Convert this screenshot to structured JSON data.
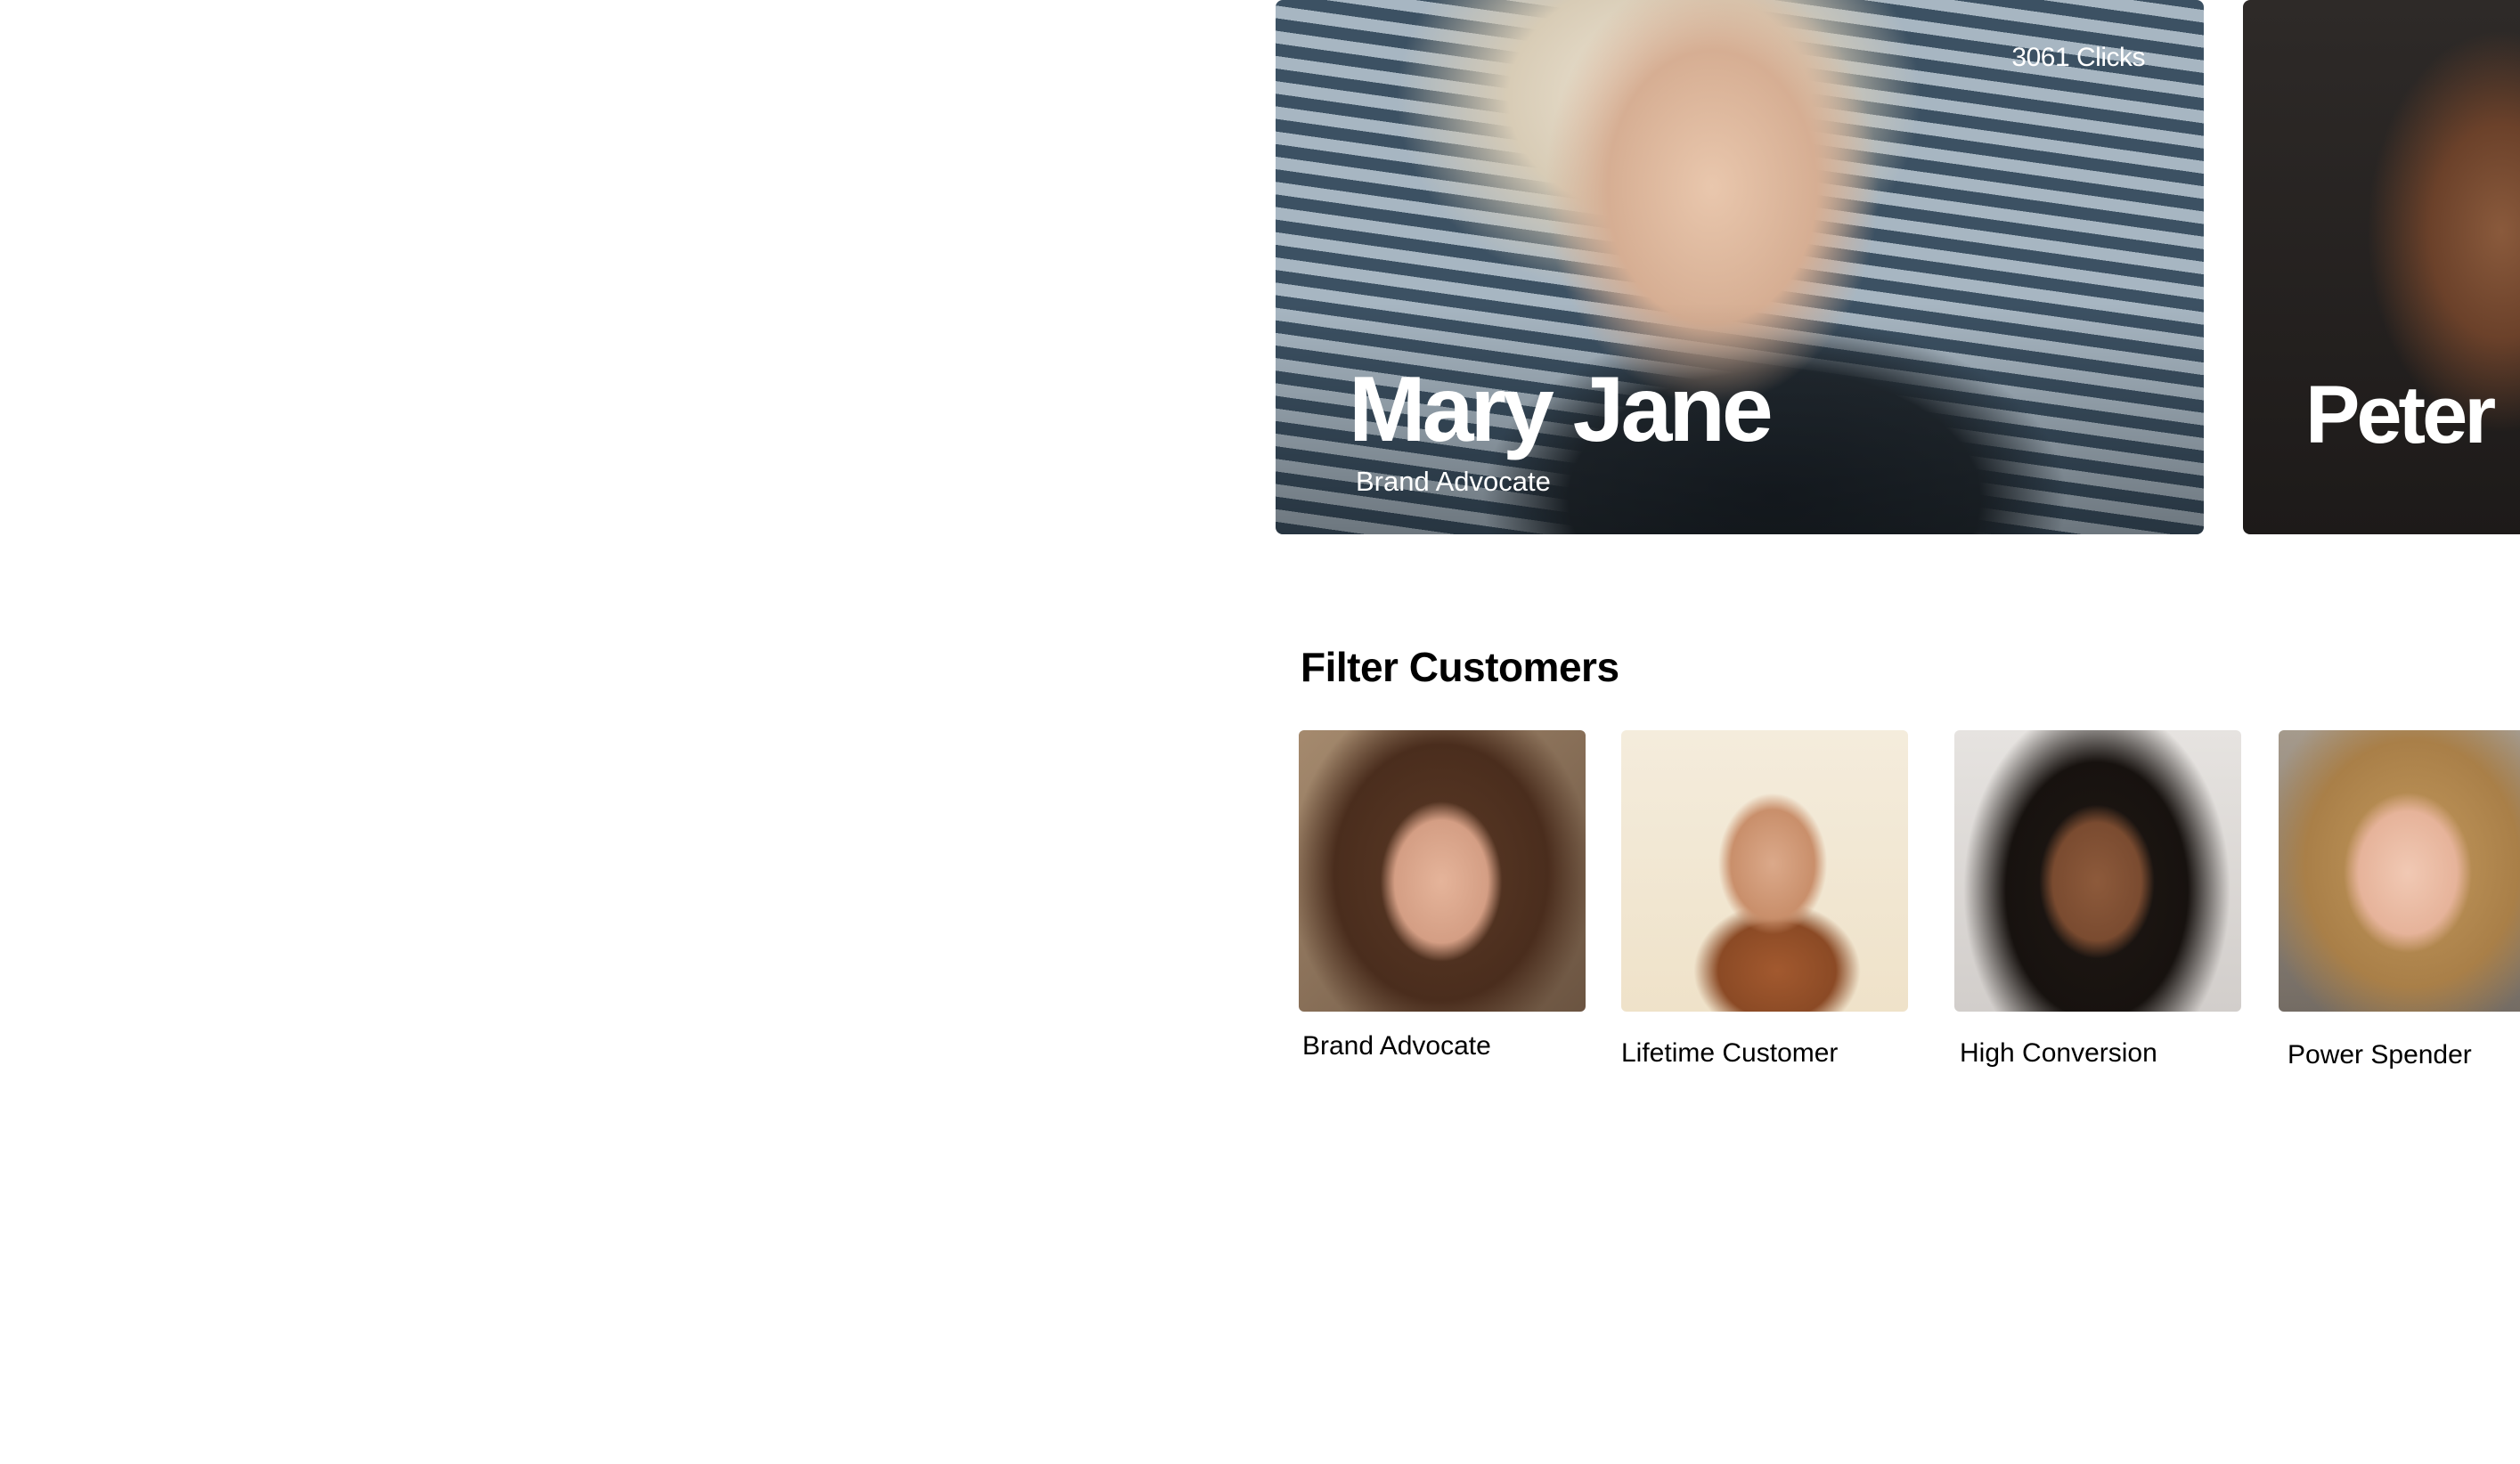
{
  "featured": {
    "main": {
      "clicks": "3061 Clicks",
      "name": "Mary Jane",
      "role": "Brand Advocate"
    },
    "next": {
      "name": "Peter"
    }
  },
  "filter": {
    "title": "Filter Customers",
    "items": [
      {
        "label": "Brand Advocate"
      },
      {
        "label": "Lifetime Customer"
      },
      {
        "label": "High Conversion"
      },
      {
        "label": "Power Spender"
      }
    ]
  }
}
